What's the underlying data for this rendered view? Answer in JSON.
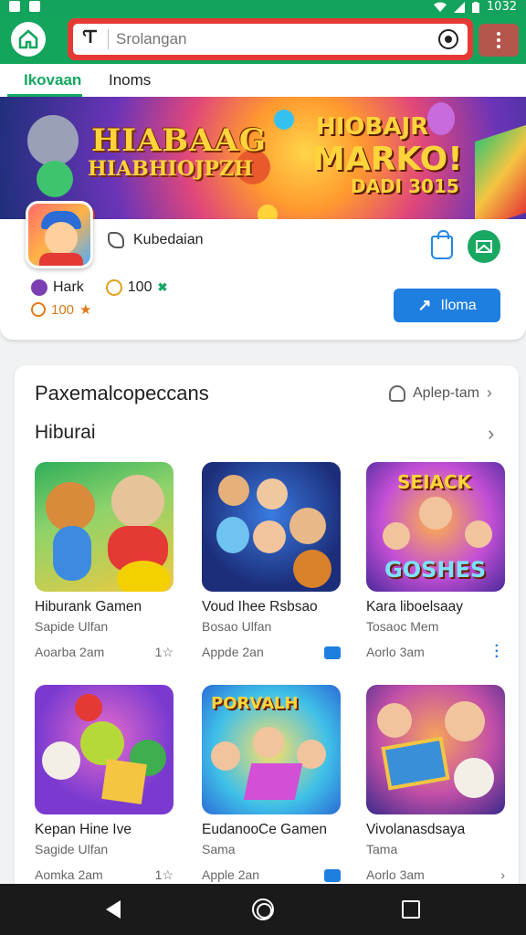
{
  "status_bar": {
    "time": "1032"
  },
  "search": {
    "placeholder": "Srolangan",
    "value": ""
  },
  "tabs": [
    {
      "label": "Ikovaan",
      "active": true
    },
    {
      "label": "Inoms",
      "active": false
    }
  ],
  "banner": {
    "title_line1": "HIABAAG",
    "title_line2": "HIABHIOJPZH",
    "right_line1": "HIOBAJR",
    "right_line2": "MARKO!",
    "right_line3": "DADI 3015"
  },
  "app": {
    "publisher": "Kubedaian",
    "stat_name": "Hark",
    "stat_count": "100",
    "stat_mark": "✖",
    "rating": "100",
    "install_label": "Iloma"
  },
  "recommend": {
    "title": "Paxemalcopeccans",
    "link_label": "Aplep-tam",
    "section_title": "Hiburai",
    "cards": [
      {
        "title": "Hiburank Gamen",
        "subtitle": "Sapide Ulfan",
        "meta": "Aoarba 2am",
        "meta_right": "1☆",
        "right_icon": "star-rating",
        "thumb": "thumb-bears",
        "thumb_text": ""
      },
      {
        "title": "Voud Ihee Rsbsao",
        "subtitle": "Bosao Ulfan",
        "meta": "Appde 2an",
        "meta_right": "",
        "right_icon": "badge",
        "thumb": "thumb-characters",
        "thumb_text": ""
      },
      {
        "title": "Kara liboelsaay",
        "subtitle": "Tosaoc Mem",
        "meta": "Aorlo 3am",
        "meta_right": "",
        "right_icon": "more",
        "thumb": "thumb-goshes",
        "thumb_text": "GOSHES"
      },
      {
        "title": "Kepan Hine Ive",
        "subtitle": "Sagide Ulfan",
        "meta": "Aomka 2am",
        "meta_right": "1☆",
        "right_icon": "star-rating",
        "thumb": "thumb-blocks",
        "thumb_text": ""
      },
      {
        "title": "EudanooCe Gamen",
        "subtitle": "Sama",
        "meta": "Apple 2an",
        "meta_right": "",
        "right_icon": "badge",
        "thumb": "thumb-porvalh",
        "thumb_text": "PORVALH"
      },
      {
        "title": "Vivolanasdsaya",
        "subtitle": "Tama",
        "meta": "Aorlo 3am",
        "meta_right": "",
        "right_icon": "chevron",
        "thumb": "thumb-box",
        "thumb_text": ""
      }
    ]
  },
  "colors": {
    "brand_green": "#14a55d",
    "search_border": "#e53935",
    "primary_blue": "#1f7fe0",
    "rating_orange": "#e07a17"
  }
}
